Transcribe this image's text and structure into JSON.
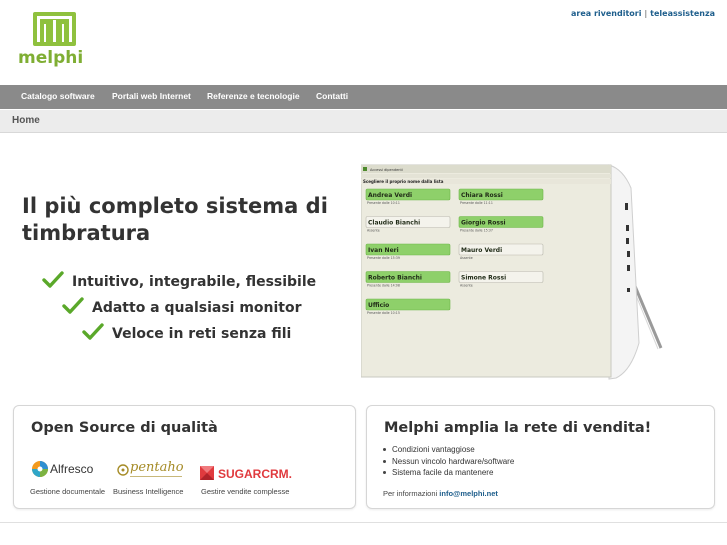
{
  "header": {
    "top_links": [
      "area rivenditori",
      "teleassistenza"
    ],
    "top_link_separator": "|",
    "logo_text": "melphi",
    "brand_color": "#8fc13e"
  },
  "nav": {
    "items": [
      "Catalogo software",
      "Portali web Internet",
      "Referenze e tecnologie",
      "Contatti"
    ],
    "background": "#8a8a8a"
  },
  "breadcrumb": "Home",
  "hero": {
    "title": "Il più completo sistema di timbratura",
    "features": [
      "Intuitivo, integrabile, flessibile",
      "Adatto a qualsiasi monitor",
      "Veloce in reti senza fili"
    ],
    "check_color": "#5aa82a"
  },
  "screenshot": {
    "window_title": "Accessi dipendenti",
    "instruction": "Scegliere il proprio nome dalla lista",
    "employees": [
      {
        "name": "Andrea Verdi",
        "status": "present",
        "note": "Presente dalle 10:11"
      },
      {
        "name": "Chiara Rossi",
        "status": "present",
        "note": "Presente dalle 11:11"
      },
      {
        "name": "Claudio Bianchi",
        "status": "absent",
        "note": "Assente"
      },
      {
        "name": "Giorgio Rossi",
        "status": "present",
        "note": "Presente dalle 15:37"
      },
      {
        "name": "Ivan Neri",
        "status": "present",
        "note": "Presente dalle 15:39"
      },
      {
        "name": "Mauro Verdi",
        "status": "absent",
        "note": "Assente"
      },
      {
        "name": "Roberto Bianchi",
        "status": "present",
        "note": "Presente dalle 14:08"
      },
      {
        "name": "Simone Rossi",
        "status": "absent",
        "note": "Assente"
      },
      {
        "name": "Ufficio",
        "status": "present",
        "note": "Presente dalle 10:15"
      }
    ]
  },
  "open_source_box": {
    "title": "Open Source di qualità",
    "logos": [
      {
        "name": "Alfresco",
        "icon": "alfresco-logo",
        "caption": "Gestione documentale"
      },
      {
        "name": "pentaho",
        "icon": "pentaho-logo",
        "caption": "Business Intelligence"
      },
      {
        "name": "SUGARCRM.",
        "icon": "sugarcrm-logo",
        "caption": "Gestire vendite complesse"
      }
    ]
  },
  "sales_box": {
    "title": "Melphi amplia la rete di vendita!",
    "bullets": [
      "Condizioni vantaggiose",
      "Nessun vincolo hardware/software",
      "Sistema facile da mantenere"
    ],
    "contact_prefix": "Per informazioni",
    "contact_email": "info@melphi.net"
  }
}
